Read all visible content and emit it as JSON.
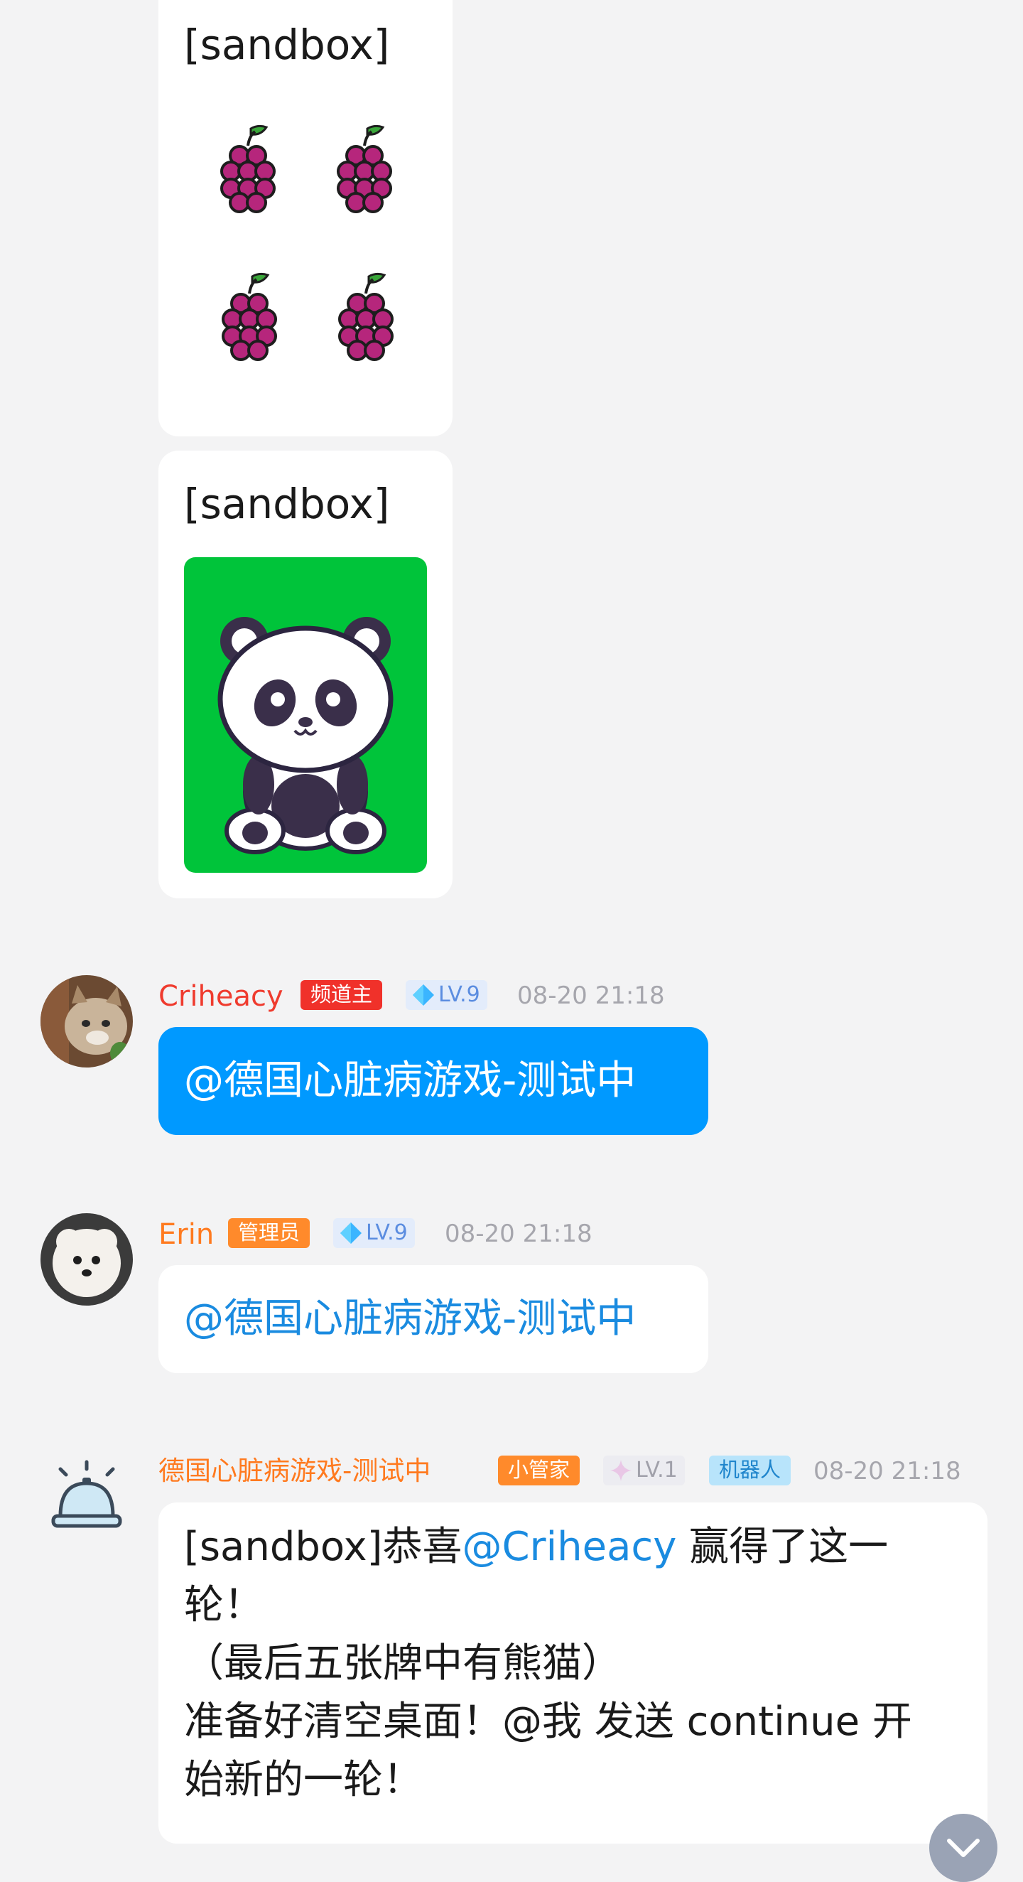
{
  "card1": {
    "label": "[sandbox]",
    "fruit": "grape-icon",
    "count": 4
  },
  "card2": {
    "label": "[sandbox]",
    "image": "panda-icon",
    "bg": "#00c43a"
  },
  "messages": [
    {
      "user": "Criheacy",
      "name_color": "#ef3b2e",
      "role": "频道主",
      "role_color": "#f0312a",
      "level": "LV.9",
      "time": "08-20 21:18",
      "text": "@德国心脏病游戏-测试中",
      "bubble_color": "#0099ff"
    },
    {
      "user": "Erin",
      "name_color": "#ff7a1f",
      "role": "管理员",
      "role_color": "#ff8a2b",
      "level": "LV.9",
      "time": "08-20 21:18",
      "text": "@德国心脏病游戏-测试中",
      "bubble_color": "#ffffff"
    },
    {
      "user": "德国心脏病游戏-测试中",
      "name_color": "#ff7a1f",
      "role": "小管家",
      "role_color": "#ff8a2b",
      "level": "LV.1",
      "bot_tag": "机器人",
      "time": "08-20 21:18",
      "line1_prefix": "[sandbox]恭喜",
      "line1_mention": "@Criheacy",
      "line1_suffix": " 赢得了这一",
      "line2": "轮！",
      "line3": "（最后五张牌中有熊猫）",
      "line4": "准备好清空桌面！@我 发送 continue 开",
      "line5": "始新的一轮！"
    }
  ]
}
